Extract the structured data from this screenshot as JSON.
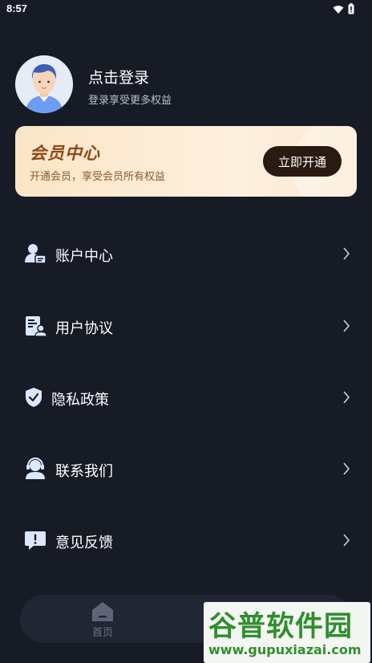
{
  "status_bar": {
    "time": "8:57",
    "icons": [
      "wifi-icon",
      "battery-icon"
    ]
  },
  "profile": {
    "title": "点击登录",
    "subtitle": "登录享受更多权益"
  },
  "vip": {
    "title": "会员中心",
    "description": "开通会员，享受会员所有权益",
    "button_label": "立即开通",
    "colors": {
      "card_start": "#fbe5c6",
      "card_end": "#fdf0de",
      "title": "#8a4a1a",
      "button_bg": "#2b1a12"
    }
  },
  "menu": {
    "items": [
      {
        "label": "账户中心",
        "icon": "account-icon"
      },
      {
        "label": "用户协议",
        "icon": "agreement-icon"
      },
      {
        "label": "隐私政策",
        "icon": "shield-icon"
      },
      {
        "label": "联系我们",
        "icon": "customer-service-icon"
      },
      {
        "label": "意见反馈",
        "icon": "feedback-icon"
      }
    ]
  },
  "tabbar": {
    "tabs": [
      {
        "label": "首页",
        "icon": "home-icon"
      },
      {
        "label": "",
        "icon": "profile-tab-icon"
      }
    ]
  },
  "watermark": {
    "title": "谷普软件园",
    "url": "www.gupuxiazai.com"
  },
  "colors": {
    "background": "#161b25",
    "accent_icon": "#dce6ff",
    "watermark_green": "#2f8f2c"
  }
}
